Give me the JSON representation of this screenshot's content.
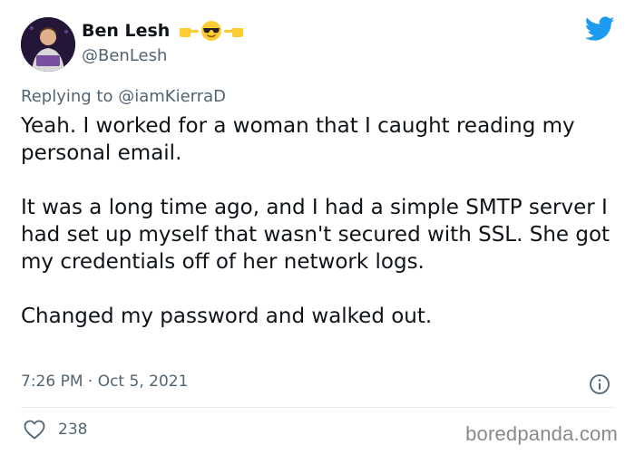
{
  "author": {
    "name": "Ben Lesh",
    "handle": "@BenLesh",
    "name_emojis": [
      "pointing-right-hand-icon",
      "sunglasses-face-icon",
      "pointing-left-hand-icon"
    ]
  },
  "reply": {
    "prefix": "Replying to",
    "mention": "@iamKierraD"
  },
  "tweet": {
    "paragraphs": [
      "Yeah. I worked for a woman that I caught reading my personal email.",
      "It was a long time ago, and I had a simple SMTP server I had set up myself that wasn't secured with SSL. She got my credentials off of her network logs.",
      "Changed my password and walked out."
    ],
    "timestamp": "7:26 PM · Oct 5, 2021"
  },
  "engagement": {
    "likes": "238"
  },
  "watermark": "boredpanda.com",
  "colors": {
    "twitter_blue": "#1d9bf0",
    "secondary_text": "#536471",
    "primary_text": "#0f1419",
    "emoji_yellow": "#ffcc33"
  }
}
